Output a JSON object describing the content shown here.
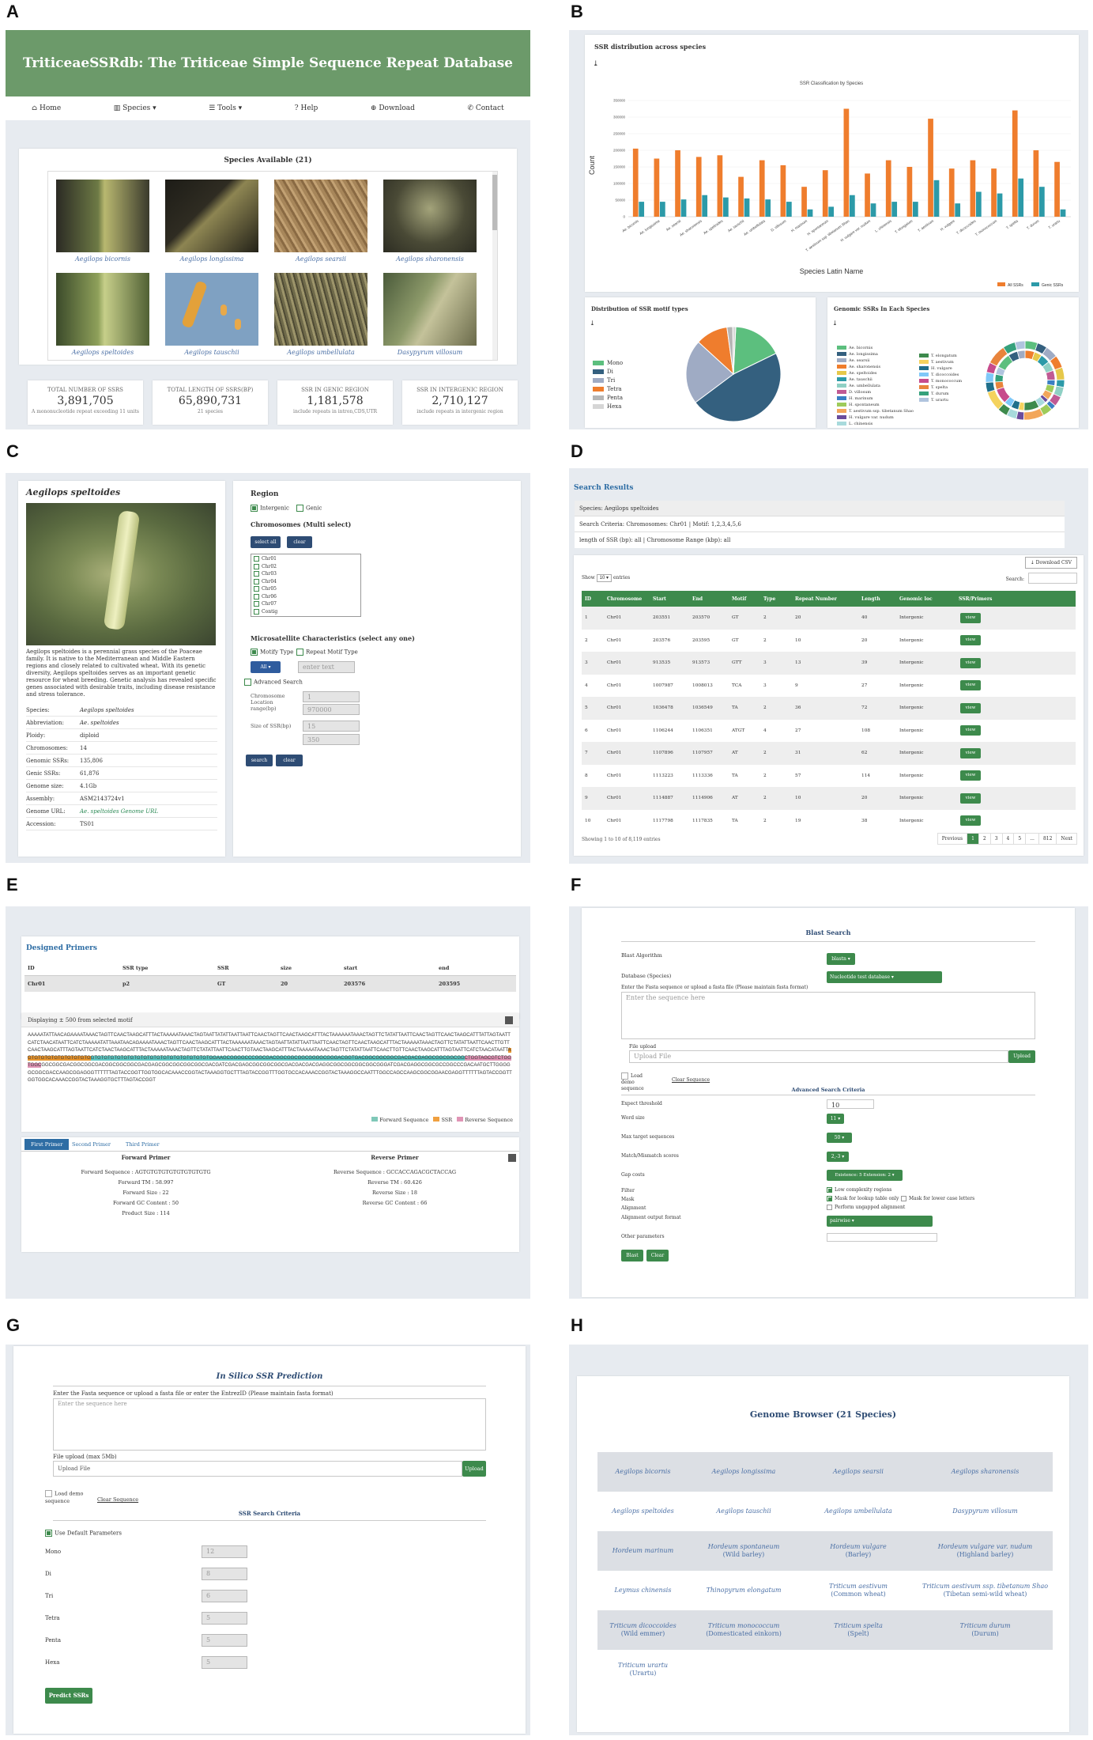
{
  "panel_labels": [
    "A",
    "B",
    "C",
    "D",
    "E",
    "F",
    "G",
    "H"
  ],
  "A": {
    "title": "TriticeaeSSRdb: The Triticeae Simple Sequence Repeat Database",
    "nav": [
      "Home",
      "Species ▾",
      "Tools ▾",
      "Help",
      "Download",
      "Contact"
    ],
    "species_box_title": "Species Available (21)",
    "species": [
      "Aegilops bicornis",
      "Aegilops longissima",
      "Aegilops searsii",
      "Aegilops sharonensis",
      "Aegilops speltoides",
      "Aegilops tauschii",
      "Aegilops umbellulata",
      "Dasypyrum villosum"
    ],
    "stats": [
      {
        "label": "TOTAL NUMBER OF SSRS",
        "value": "3,891,705",
        "sub": "A mononucleotide repeat exceeding 11 units"
      },
      {
        "label": "TOTAL LENGTH OF SSRS(BP)",
        "value": "65,890,731",
        "sub": "21 species"
      },
      {
        "label": "SSR IN GENIC REGION",
        "value": "1,181,578",
        "sub": "include repeats in intron,CDS,UTR"
      },
      {
        "label": "SSR IN INTERGENIC REGION",
        "value": "2,710,127",
        "sub": "include repeats in intergenic region"
      }
    ]
  },
  "B": {
    "card1_title": "SSR distribution across species",
    "chart_data": [
      {
        "type": "bar",
        "title": "SSR Classification by Species",
        "xlabel": "Species Latin Name",
        "ylabel": "Count",
        "ylim": [
          0,
          350000
        ],
        "yticks": [
          "0",
          "50000",
          "100000",
          "150000",
          "200000",
          "250000",
          "300000",
          "350000"
        ],
        "categories": [
          "Ae. bicornis",
          "Ae. longissima",
          "Ae. searsii",
          "Ae. sharonensis",
          "Ae. speltoides",
          "Ae. tauschii",
          "Ae. umbellulata",
          "D. villosum",
          "H. marinum",
          "H. spontaneum",
          "T. aestivum ssp. tibetanum Shao",
          "H. vulgare var. nudum",
          "L. chinensis",
          "T. elongatum",
          "T. aestivum",
          "H. vulgare",
          "T. dicoccoides",
          "T. monococcum",
          "T. spelta",
          "T. durum",
          "T. urartu"
        ],
        "series": [
          {
            "name": "All SSRs",
            "color": "#ef7d2d",
            "values": [
              205000,
              175000,
              200000,
              180000,
              185000,
              120000,
              170000,
              155000,
              90000,
              140000,
              325000,
              130000,
              170000,
              150000,
              295000,
              145000,
              170000,
              145000,
              320000,
              200000,
              165000
            ]
          },
          {
            "name": "Genic SSRs",
            "color": "#2c9aa8",
            "values": [
              45000,
              45000,
              52000,
              65000,
              58000,
              55000,
              52000,
              45000,
              22000,
              30000,
              65000,
              40000,
              45000,
              45000,
              110000,
              40000,
              75000,
              70000,
              115000,
              90000,
              22000
            ]
          }
        ],
        "legend": "bottom-right"
      },
      {
        "type": "pie",
        "title": "Distribution of SSR motif types",
        "categories": [
          "Mono",
          "Di",
          "Tri",
          "Tetra",
          "Penta",
          "Hexa"
        ],
        "values": [
          17,
          47,
          22,
          11,
          2,
          1
        ],
        "colors": [
          "#5cbf7e",
          "#34607f",
          "#9fabc4",
          "#ef7d2d",
          "#b6b6b6",
          "#d6d6d6"
        ],
        "legend": "left"
      },
      {
        "type": "pie",
        "title": "Genomic SSRs In Each Species",
        "legend": "left",
        "categories": [
          "Ae. bicornis",
          "Ae. longissima",
          "Ae. searsii",
          "Ae. sharonensis",
          "Ae. speltoides",
          "Ae. tauschii",
          "Ae. umbellulata",
          "D. villosum",
          "H. marinum",
          "H. spontaneum",
          "T. aestivum ssp. tibetanum Shao",
          "H. vulgare var. nudum",
          "L. chinensis",
          "T. elongatum",
          "T. aestivum",
          "H. vulgare",
          "T. dicoccoides",
          "T. monococcum",
          "T. spelta",
          "T. durum",
          "T. urartu"
        ],
        "values": [
          5,
          4,
          5,
          5,
          5,
          3,
          4,
          4,
          2,
          4,
          8,
          3,
          4,
          4,
          8,
          4,
          4,
          4,
          8,
          5,
          4
        ]
      }
    ]
  },
  "C": {
    "species_title": "Aegilops speltoides",
    "description": "Aegilops speltoides is a perennial grass species of the Poaceae family. It is native to the Mediterranean and Middle Eastern regions and closely related to cultivated wheat. With its genetic diversity, Aegilops speltoides serves as an important genetic resource for wheat breeding. Genetic analysis has revealed specific genes associated with desirable traits, including disease resistance and stress tolerance.",
    "info": [
      [
        "Species:",
        "Aegilops speltoides"
      ],
      [
        "Abbreviation:",
        "Ae. speltoides"
      ],
      [
        "Ploidy:",
        "diploid"
      ],
      [
        "Chromosomes:",
        "14"
      ],
      [
        "Genomic SSRs:",
        "135,806"
      ],
      [
        "Genic SSRs:",
        "61,876"
      ],
      [
        "Genome size:",
        "4.1Gb"
      ],
      [
        "Assembly:",
        "ASM2143724v1"
      ],
      [
        "Genome URL:",
        "Ae. speltoides Genome URL"
      ],
      [
        "Accession:",
        "TS01"
      ]
    ],
    "region_title": "Region",
    "region_opts": [
      "Intergenic",
      "Genic"
    ],
    "chrom_title": "Chromosomes (Multi select)",
    "select_all": "select all",
    "clear": "clear",
    "chroms": [
      "Chr01",
      "Chr02",
      "Chr03",
      "Chr04",
      "Chr05",
      "Chr06",
      "Chr07",
      "Contig"
    ],
    "micro_title": "Microsatellite Characteristics (select any one)",
    "motif_type": "Motify Type",
    "repeat_motif": "Repeat Motif Type",
    "all": "All",
    "enter_text": "enter text",
    "advanced": "Advanced Search",
    "chrom_loc": "Chromosome Location range(bp)",
    "loc_min": "1",
    "loc_max": "970000",
    "ssr_size": "Size of SSR(bp)",
    "size_min": "15",
    "size_max": "350",
    "search": "search"
  },
  "D": {
    "title": "Search Results",
    "species": "Species: Aegilops speltoides",
    "criteria": "Search Criteria: Chromosomes: Chr01 | Motif: 1,2,3,4,5,6",
    "length": "length of SSR (bp): all | Chromosome Range (kbp): all",
    "download": "⤓ Download CSV",
    "show": "Show",
    "entries": "entries",
    "show_n": "10 ▾",
    "search": "Search:",
    "headers": [
      "ID",
      "Chromosome",
      "Start",
      "End",
      "Motif",
      "Type",
      "Repeat Number",
      "Length",
      "Genomic loc",
      "SSR/Primers"
    ],
    "rows": [
      [
        "1",
        "Chr01",
        "203551",
        "203570",
        "GT",
        "2",
        "20",
        "40",
        "Intergenic"
      ],
      [
        "2",
        "Chr01",
        "203576",
        "203595",
        "GT",
        "2",
        "10",
        "20",
        "Intergenic"
      ],
      [
        "3",
        "Chr01",
        "913535",
        "913573",
        "GTT",
        "3",
        "13",
        "39",
        "Intergenic"
      ],
      [
        "4",
        "Chr01",
        "1007987",
        "1008013",
        "TCA",
        "3",
        "9",
        "27",
        "Intergenic"
      ],
      [
        "5",
        "Chr01",
        "1036478",
        "1036549",
        "TA",
        "2",
        "36",
        "72",
        "Intergenic"
      ],
      [
        "6",
        "Chr01",
        "1106244",
        "1106351",
        "ATGT",
        "4",
        "27",
        "108",
        "Intergenic"
      ],
      [
        "7",
        "Chr01",
        "1107896",
        "1107957",
        "AT",
        "2",
        "31",
        "62",
        "Intergenic"
      ],
      [
        "8",
        "Chr01",
        "1113223",
        "1113336",
        "TA",
        "2",
        "57",
        "114",
        "Intergenic"
      ],
      [
        "9",
        "Chr01",
        "1114887",
        "1114906",
        "AT",
        "2",
        "10",
        "20",
        "Intergenic"
      ],
      [
        "10",
        "Chr01",
        "1117798",
        "1117835",
        "TA",
        "2",
        "19",
        "38",
        "Intergenic"
      ]
    ],
    "view": "view",
    "footer": "Showing 1 to 10 of 8,119 entries",
    "pager": [
      "Previous",
      "1",
      "2",
      "3",
      "4",
      "5",
      "...",
      "812",
      "Next"
    ]
  },
  "E": {
    "title": "Designed Primers",
    "headers": [
      "ID",
      "SSR type",
      "SSR",
      "size",
      "start",
      "end"
    ],
    "row": [
      "Chr01",
      "p2",
      "GT",
      "20",
      "203576",
      "203595"
    ],
    "display": "Displaying ± 500 from selected motif",
    "seq_a": "AAAAATATTAACAGAAAATAAACTAGTTCAACTAAGCATTTACTAAAAATAAACTAGTAATTATATTAATTAATTCAACTAGTTCAACTAAGCATTTACTAAAAAATAAACTAGTTCTATATTAATTCAACTAGTTCAACTAAGCATTTATTAGTAATTCATCTAACATAATTCATCTAAAAATATTAAATAACAGAAAATAAACTAGTTCAACTAAGCATTTACTAAAAAATAAACTAGTAATTATATTAATTAATTCAACTAGTTCAACTAAGCATTTACTAAAAATAAACTAGTTCTATATTAATTCAACTTGTTCAACTAAGCATTTAGTAATTCATCTAACTAAGCATTTACTAAAAATAAACTAGTTCTATATTAATTCAACTTGTAACTAAGCATTTACTAAAAATAAACTAGTTCTATATTAATTCAACTTGTTCAACTAAGCATTTAGTAATTCATCTAACATAATT",
    "fwd_seq": "AGTGTGTGTGTGTGTGTGTG",
    "seq_b": "GTGTGTGTGTGTGTGTGTGTGTGTGTGTGTGTGTGTGGAAGCGGGGCCCGGCGACGGCGGCGGCGGGGCGGGACGGTGACGGCGGCGGCGACGACGAGGCGGCGGCGG",
    "rev_seq": "CTGGTAGCGTCTGGTGGC",
    "seq_c": "GGCGGCGACGGCGGCGACGGCGGCGGCGACGAGCGGCGGCGGCGGCGACGATCGACGAGCGGCGGCGGCGACGACGACGAGGCGGCGGCGGCGGCGGGATCGACGAGGCGGCGCCGGCCCGACAATGCTTGGGGGCGGCGACCAAGCGGAGGGTTTTTTAGTACCGGTTGGTGGCACAAACCGGTACTAAAGGTGCTTTAGTACCGGTTTGGTGCCACAAACCGGTACTAAAGGCCAATTTGGCCAGCCAAGCGGCGGAACGAGGTTTTTTAGTACCGGTTGGTGGCACAAACCGGTACTAAAGGTGCTTTAGTACCGGT",
    "legend": [
      "Forward Sequence",
      "SSR",
      "Reverse Sequence"
    ],
    "tabs": [
      "First Primer",
      "Second Primer",
      "Third Primer"
    ],
    "fwd_title": "Forward Primer",
    "rev_title": "Reverse Primer",
    "fwd": [
      "Forward Sequence : AGTGTGTGTGTGTGTGTGTG",
      "Forward TM : 58.997",
      "Forward Size : 22",
      "Forward GC Content : 50",
      "Product Size : 114"
    ],
    "rev": [
      "Reverse Sequence : GCCACCAGACGCTACCAG",
      "Reverse TM : 60.426",
      "Reverse Size : 18",
      "Reverse GC Content : 66"
    ]
  },
  "F": {
    "title": "Blast Search",
    "algorithm_label": "Blast Algorithm",
    "algorithm": "blastn ▾",
    "db_label": "Database (Species)",
    "db": "Nucleotide test database ▾",
    "enter_label": "Enter the Fasta sequence or upload a fasta file (Please maintain fasta format)",
    "placeholder": "Enter the sequence here",
    "upload_label": "File upload",
    "upload_ph": "Upload File",
    "upload_btn": "Upload",
    "load_demo": "Load demo sequence",
    "clear_seq": "Clear Sequence",
    "adv": "Advanced Search Criteria",
    "params": [
      [
        "Expect threshold",
        "10"
      ],
      [
        "Word size",
        "11 ▾"
      ],
      [
        "Max target sequences",
        "50 ▾"
      ],
      [
        "Match/Mismatch scores",
        "2,-3 ▾"
      ],
      [
        "Gap costs",
        "Existence: 5 Extension: 2 ▾"
      ]
    ],
    "filter": "Filter",
    "low_complex": "Low complexity regions",
    "mask": "Mask",
    "mask_lookup": "Mask for lookup table only",
    "mask_lower": "Mask for lower case letters",
    "alignment": "Alignment",
    "perform": "Perform ungapped alignment",
    "align_fmt": "Alignment output format",
    "pairwise": "pairwise ▾",
    "other": "Other parameters",
    "blast": "Blast",
    "clear": "Clear"
  },
  "G": {
    "title": "In Silico SSR Prediction",
    "enter_label": "Enter the Fasta sequence or upload a fasta file or enter the EntrezID (Please maintain fasta format)",
    "placeholder": "Enter the sequence here",
    "upload_label": "File upload (max 5Mb)",
    "upload_ph": "Upload File",
    "upload_btn": "Upload",
    "load_demo": "Load demo sequence",
    "clear_seq": "Clear Sequence",
    "criteria": "SSR Search Criteria",
    "default": "Use Default Parameters",
    "params": [
      [
        "Mono",
        "12"
      ],
      [
        "Di",
        "8"
      ],
      [
        "Tri",
        "6"
      ],
      [
        "Tetra",
        "5"
      ],
      [
        "Penta",
        "5"
      ],
      [
        "Hexa",
        "5"
      ]
    ],
    "predict": "Predict SSRs"
  },
  "H": {
    "title": "Genome Browser (21 Species)",
    "cells": [
      [
        [
          "Aegilops bicornis",
          ""
        ],
        [
          "Aegilops longissima",
          ""
        ],
        [
          "Aegilops searsii",
          ""
        ],
        [
          "Aegilops sharonensis",
          ""
        ]
      ],
      [
        [
          "Aegilops speltoides",
          ""
        ],
        [
          "Aegilops tauschii",
          ""
        ],
        [
          "Aegilops umbellulata",
          ""
        ],
        [
          "Dasypyrum villosum",
          ""
        ]
      ],
      [
        [
          "Hordeum marinum",
          ""
        ],
        [
          "Hordeum spontaneum",
          "(Wild barley)"
        ],
        [
          "Hordeum vulgare",
          "(Barley)"
        ],
        [
          "Hordeum vulgare var. nudum",
          "(Highland barley)"
        ]
      ],
      [
        [
          "Leymus chinensis",
          ""
        ],
        [
          "Thinopyrum elongatum",
          ""
        ],
        [
          "Triticum aestivum",
          "(Common wheat)"
        ],
        [
          "Triticum aestivum ssp. tibetanum Shao",
          "(Tibetan semi-wild wheat)"
        ]
      ],
      [
        [
          "Triticum dicoccoides",
          "(Wild emmer)"
        ],
        [
          "Triticum monococcum",
          "(Domesticated einkorn)"
        ],
        [
          "Triticum spelta",
          "(Spelt)"
        ],
        [
          "Triticum durum",
          "(Durum)"
        ]
      ],
      [
        [
          "Triticum urartu",
          "(Urartu)"
        ]
      ]
    ]
  }
}
